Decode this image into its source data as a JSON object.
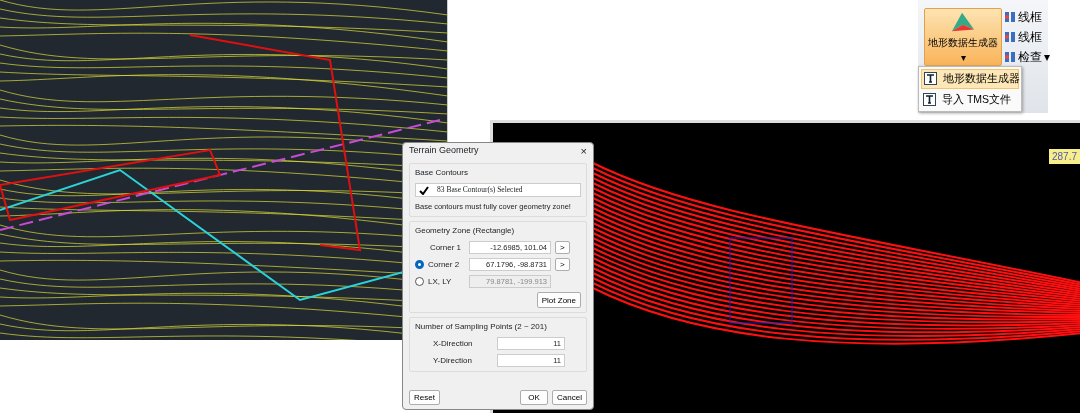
{
  "ribbon": {
    "main_button": {
      "label": "地形数据生成器",
      "caret": "▾"
    },
    "side_items": [
      {
        "label": "线框"
      },
      {
        "label": "线框"
      },
      {
        "label": "检查",
        "caret": "▾"
      }
    ],
    "menu": [
      {
        "label": "地形数据生成器",
        "selected": true
      },
      {
        "label": "导入 TMS文件",
        "selected": false
      }
    ]
  },
  "viewport": {
    "coordinate_label": "287.7"
  },
  "dialog": {
    "title": "Terrain Geometry",
    "close": "×",
    "base_contours": {
      "title": "Base Contours",
      "checked": true,
      "selection": "83 Base Contour(s) Selected",
      "note": "Base contours must fully cover geometry zone!"
    },
    "geometry_zone": {
      "title": "Geometry Zone (Rectangle)",
      "rows": [
        {
          "kind": "label",
          "label": "Corner 1",
          "value": "-12.6985, 101.04",
          "pick": ">",
          "disabled": false
        },
        {
          "kind": "radio",
          "label": "Corner 2",
          "selected": true,
          "value": "67.1796, -98.8731",
          "pick": ">",
          "disabled": false
        },
        {
          "kind": "radio",
          "label": "LX, LY",
          "selected": false,
          "value": "79.8781, -199.913",
          "disabled": true
        }
      ],
      "plot_button": "Plot Zone"
    },
    "sampling": {
      "title": "Number of Sampling Points (2 ~ 201)",
      "rows": [
        {
          "label": "X-Direction",
          "value": "11"
        },
        {
          "label": "Y-Direction",
          "value": "11"
        }
      ]
    },
    "buttons": {
      "reset": "Reset",
      "ok": "OK",
      "cancel": "Cancel"
    }
  }
}
